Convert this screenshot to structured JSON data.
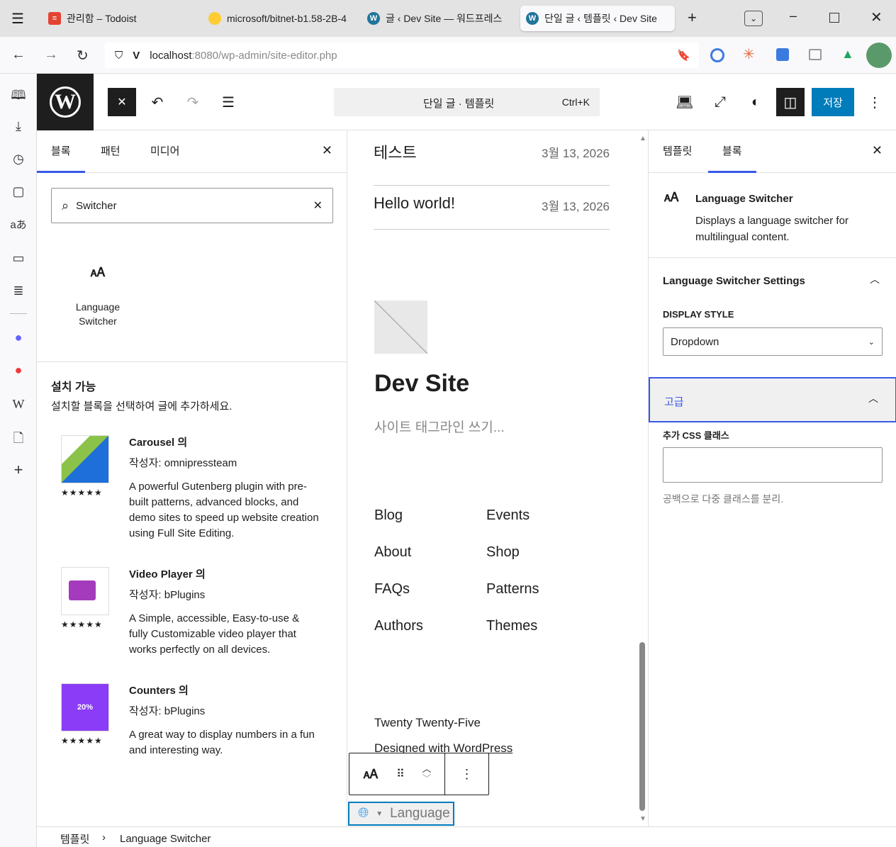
{
  "browser": {
    "tabs": [
      {
        "title": "관리함 – Todoist"
      },
      {
        "title": "microsoft/bitnet-b1.58-2B-4"
      },
      {
        "title": "글 ‹ Dev Site — 워드프레스"
      },
      {
        "title": "단일 글 ‹ 템플릿 ‹ Dev Site"
      }
    ],
    "url_host": "localhost",
    "url_rest": ":8080/wp-admin/site-editor.php"
  },
  "header": {
    "command_title": "단일 글 · 템플릿",
    "shortcut": "Ctrl+K",
    "save_label": "저장"
  },
  "inserter": {
    "tabs": [
      "블록",
      "패턴",
      "미디어"
    ],
    "search_value": "Switcher",
    "result_label": "Language Switcher",
    "install_heading": "설치 가능",
    "install_desc": "설치할 블록을 선택하여 글에 추가하세요.",
    "plugins": [
      {
        "name": "Carousel 의",
        "author": "작성자: omnipressteam",
        "desc": "A powerful Gutenberg plugin with pre-built patterns, advanced blocks, and demo sites to speed up website creation using Full Site Editing.",
        "stars": "★★★★★"
      },
      {
        "name": "Video Player 의",
        "author": "작성자: bPlugins",
        "desc": "A Simple, accessible, Easy-to-use & fully Customizable video player that works perfectly on all devices.",
        "stars": "★★★★★"
      },
      {
        "name": "Counters 의",
        "author": "작성자: bPlugins",
        "desc": "A great way to display numbers in a fun and interesting way.",
        "stars": "★★★★★",
        "badge": "20%"
      }
    ]
  },
  "canvas": {
    "posts": [
      {
        "title": "테스트",
        "date": "3월 13, 2026"
      },
      {
        "title": "Hello world!",
        "date": "3월 13, 2026"
      }
    ],
    "site_title": "Dev Site",
    "tagline": "사이트 태그라인 쓰기...",
    "nav_col1": [
      "Blog",
      "About",
      "FAQs",
      "Authors"
    ],
    "nav_col2": [
      "Events",
      "Shop",
      "Patterns",
      "Themes"
    ],
    "footer_theme": "Twenty Twenty-Five",
    "footer_credit": "Designed with WordPress",
    "lang_select": "Language"
  },
  "settings": {
    "tabs": [
      "템플릿",
      "블록"
    ],
    "block_title": "Language Switcher",
    "block_desc": "Displays a language switcher for multilingual content.",
    "panel_title": "Language Switcher Settings",
    "display_style_label": "DISPLAY STYLE",
    "display_style_value": "Dropdown",
    "advanced_title": "고급",
    "css_label": "추가 CSS 클래스",
    "css_value": "",
    "css_help": "공백으로 다중 클래스를 분리."
  },
  "breadcrumb": {
    "root": "템플릿",
    "current": "Language Switcher"
  },
  "colors": {
    "accent": "#3858e9",
    "save": "#007cba"
  }
}
